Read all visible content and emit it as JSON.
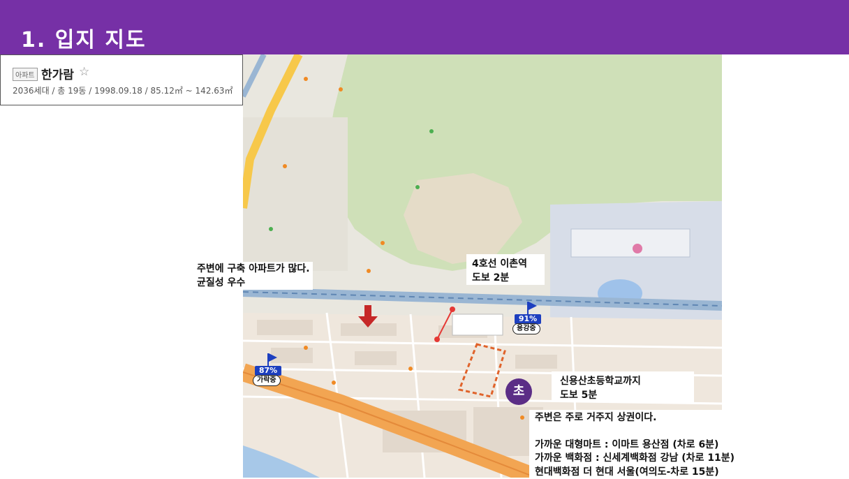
{
  "header": {
    "title": "1. 입지 지도",
    "bg_color": "#7630a6"
  },
  "complex": {
    "tag": "아파트",
    "name": "한가람",
    "star_icon": "☆",
    "meta": "2036세대 / 총 19동 / 1998.09.18 / 85.12㎡ ~ 142.63㎡"
  },
  "callouts": {
    "old_apartments": [
      "주변에 구축 아파트가 많다.",
      "균질성 우수"
    ],
    "station": [
      "4호선 이촌역",
      "도보 2분"
    ],
    "elementary": [
      "신용산초등학교까지",
      "도보 5분"
    ],
    "commercial": [
      "주변은 주로 거주지 상권이다.",
      "가까운 대형마트 : 이마트 용산점 (차로 6분)",
      "가까운 백화점 : 신세계백화점 강남 (차로 11분)",
      "현대백화점 더 현대 서울(여의도-차로 15분)"
    ]
  },
  "markers": {
    "school_marker": "초",
    "yonggang": {
      "percent": "91%",
      "label": "용강중",
      "flag_icon": "flag-icon"
    },
    "garak": {
      "percent": "87%",
      "label": "가락중",
      "flag_icon": "flag-icon"
    },
    "arrow_icon": "down-arrow-icon",
    "accent_color": "#5b2d86",
    "badge_color": "#1d3fbf"
  }
}
